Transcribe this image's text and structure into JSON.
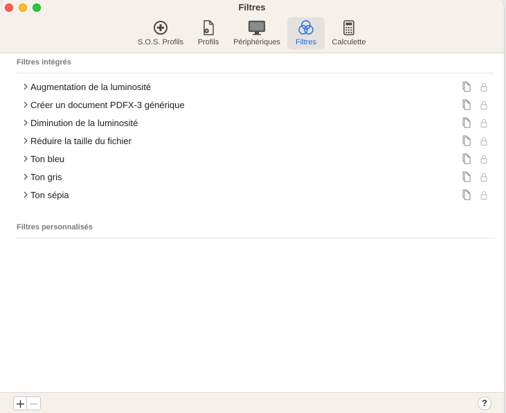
{
  "window": {
    "title": "Filtres"
  },
  "toolbar": {
    "items": [
      {
        "label": "S.O.S. Profils",
        "icon": "plus-circle-icon"
      },
      {
        "label": "Profils",
        "icon": "document-gear-icon"
      },
      {
        "label": "Périphériques",
        "icon": "monitor-icon"
      },
      {
        "label": "Filtres",
        "icon": "filter-circles-icon",
        "selected": true
      },
      {
        "label": "Calculette",
        "icon": "calculator-icon"
      }
    ],
    "selected_color": "#1f6ee0"
  },
  "builtin_section": {
    "header": "Filtres intégrés",
    "items": [
      {
        "label": "Augmentation de la luminosité"
      },
      {
        "label": "Créer un document PDFX-3 générique"
      },
      {
        "label": "Diminution de la luminosité"
      },
      {
        "label": "Réduire la taille du fichier"
      },
      {
        "label": "Ton bleu"
      },
      {
        "label": "Ton gris"
      },
      {
        "label": "Ton sépia"
      }
    ]
  },
  "custom_section": {
    "header": "Filtres personnalisés",
    "items": []
  },
  "bottombar": {
    "add_label": "+",
    "remove_label": "−",
    "help_label": "?"
  }
}
